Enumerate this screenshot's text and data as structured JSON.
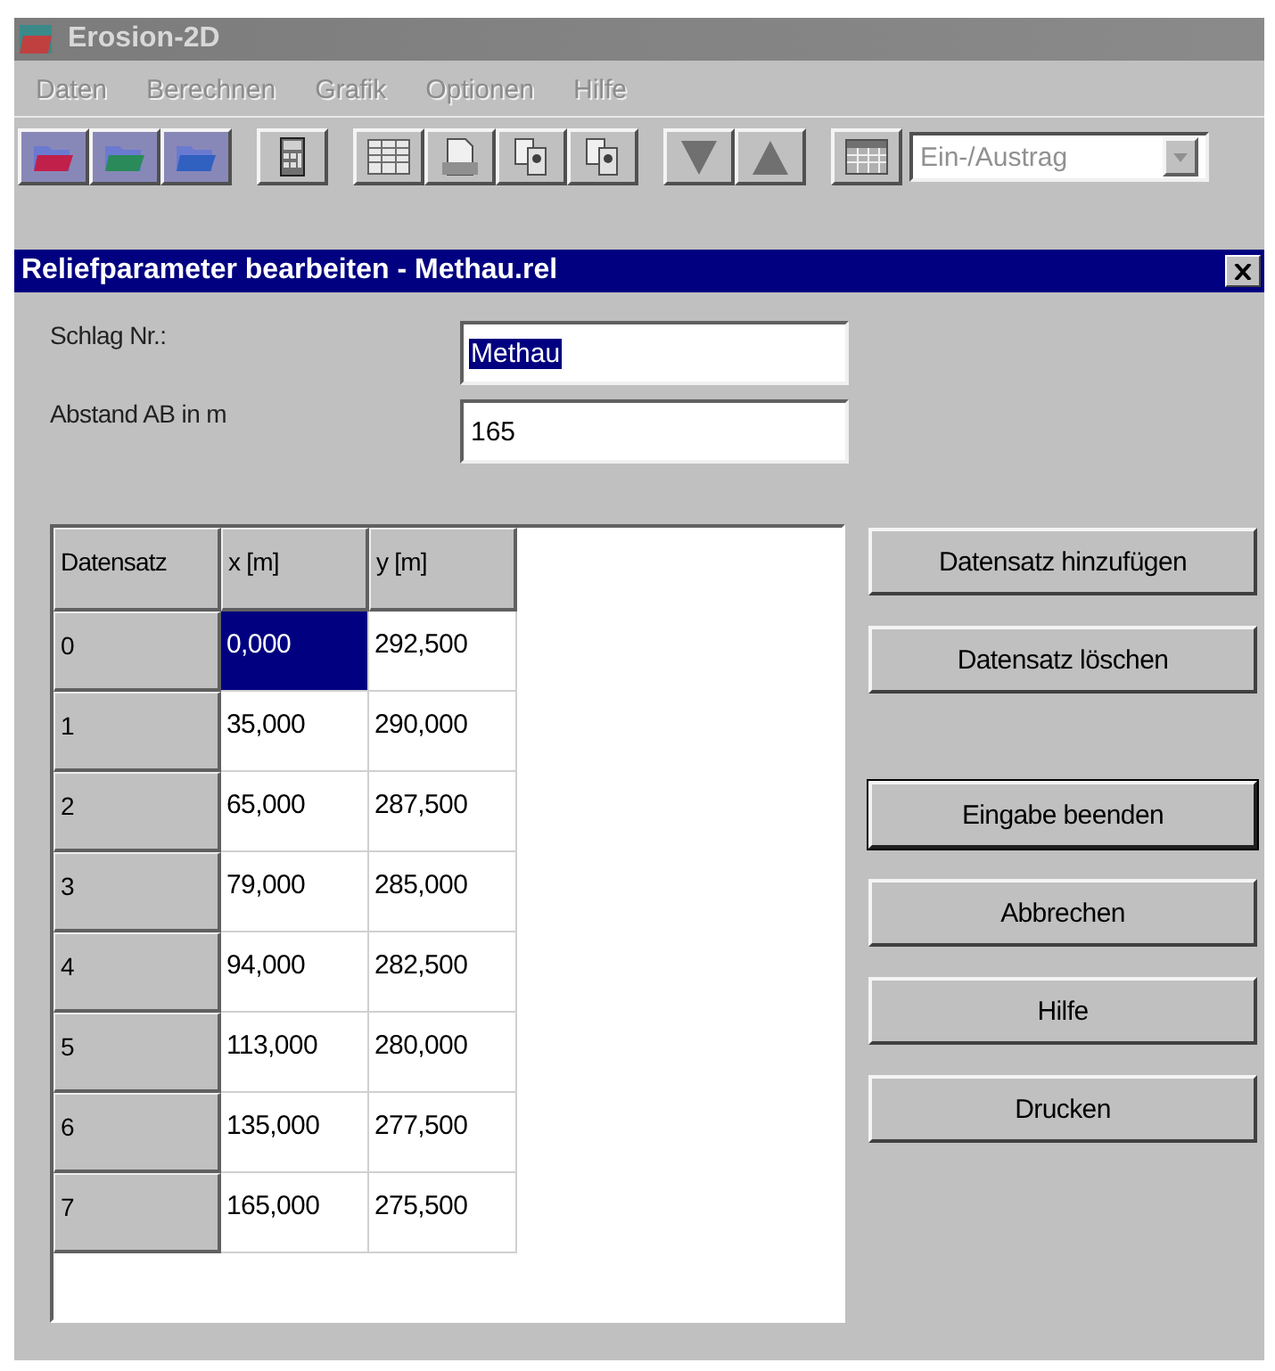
{
  "window": {
    "title": "Erosion-2D",
    "active": false
  },
  "menu": [
    {
      "label": "Daten",
      "disabled": true
    },
    {
      "label": "Berechnen",
      "disabled": true
    },
    {
      "label": "Grafik",
      "disabled": true
    },
    {
      "label": "Optionen",
      "disabled": true
    },
    {
      "label": "Hilfe",
      "disabled": true
    }
  ],
  "toolbar": [
    {
      "kind": "folder-red",
      "gap_before": false
    },
    {
      "kind": "folder-green",
      "gap_before": false
    },
    {
      "kind": "folder-blue",
      "gap_before": false
    },
    {
      "kind": "calculator",
      "gap_before": true
    },
    {
      "kind": "sheet",
      "gap_before": true
    },
    {
      "kind": "page",
      "gap_before": false
    },
    {
      "kind": "pages",
      "gap_before": false
    },
    {
      "kind": "pages",
      "gap_before": false
    },
    {
      "kind": "down",
      "gap_before": true
    },
    {
      "kind": "up",
      "gap_before": false
    },
    {
      "kind": "grid",
      "gap_before": true
    }
  ],
  "dropdown": {
    "value": "Ein-/Austrag"
  },
  "dialog": {
    "title": "Reliefparameter bearbeiten - Methau.rel",
    "fields": [
      {
        "label": "Schlag Nr.:",
        "value": "Methau",
        "selected": true
      },
      {
        "label": "Abstand AB in m",
        "value": "165",
        "selected": false
      }
    ],
    "table": {
      "columns": [
        "Datensatz",
        "x [m]",
        "y [m]"
      ],
      "rows": [
        {
          "cells": [
            {
              "text": "0",
              "kind": "header"
            },
            {
              "text": "0,000",
              "kind": "data",
              "selected": true
            },
            {
              "text": "292,500",
              "kind": "data",
              "selected": false
            }
          ]
        },
        {
          "cells": [
            {
              "text": "1",
              "kind": "header"
            },
            {
              "text": "35,000",
              "kind": "data",
              "selected": false
            },
            {
              "text": "290,000",
              "kind": "data",
              "selected": false
            }
          ]
        },
        {
          "cells": [
            {
              "text": "2",
              "kind": "header"
            },
            {
              "text": "65,000",
              "kind": "data",
              "selected": false
            },
            {
              "text": "287,500",
              "kind": "data",
              "selected": false
            }
          ]
        },
        {
          "cells": [
            {
              "text": "3",
              "kind": "header"
            },
            {
              "text": "79,000",
              "kind": "data",
              "selected": false
            },
            {
              "text": "285,000",
              "kind": "data",
              "selected": false
            }
          ]
        },
        {
          "cells": [
            {
              "text": "4",
              "kind": "header"
            },
            {
              "text": "94,000",
              "kind": "data",
              "selected": false
            },
            {
              "text": "282,500",
              "kind": "data",
              "selected": false
            }
          ]
        },
        {
          "cells": [
            {
              "text": "5",
              "kind": "header"
            },
            {
              "text": "113,000",
              "kind": "data",
              "selected": false
            },
            {
              "text": "280,000",
              "kind": "data",
              "selected": false
            }
          ]
        },
        {
          "cells": [
            {
              "text": "6",
              "kind": "header"
            },
            {
              "text": "135,000",
              "kind": "data",
              "selected": false
            },
            {
              "text": "277,500",
              "kind": "data",
              "selected": false
            }
          ]
        },
        {
          "cells": [
            {
              "text": "7",
              "kind": "header"
            },
            {
              "text": "165,000",
              "kind": "data",
              "selected": false
            },
            {
              "text": "275,500",
              "kind": "data",
              "selected": false
            }
          ]
        }
      ]
    },
    "record_buttons": [
      {
        "label": "Datensatz hinzufügen",
        "default": false
      },
      {
        "label": "Datensatz löschen",
        "default": false
      }
    ],
    "buttons": [
      {
        "label": "Eingabe beenden",
        "default": true
      },
      {
        "label": "Abbrechen",
        "default": false
      },
      {
        "label": "Hilfe",
        "default": false
      },
      {
        "label": "Drucken",
        "default": false
      }
    ]
  }
}
